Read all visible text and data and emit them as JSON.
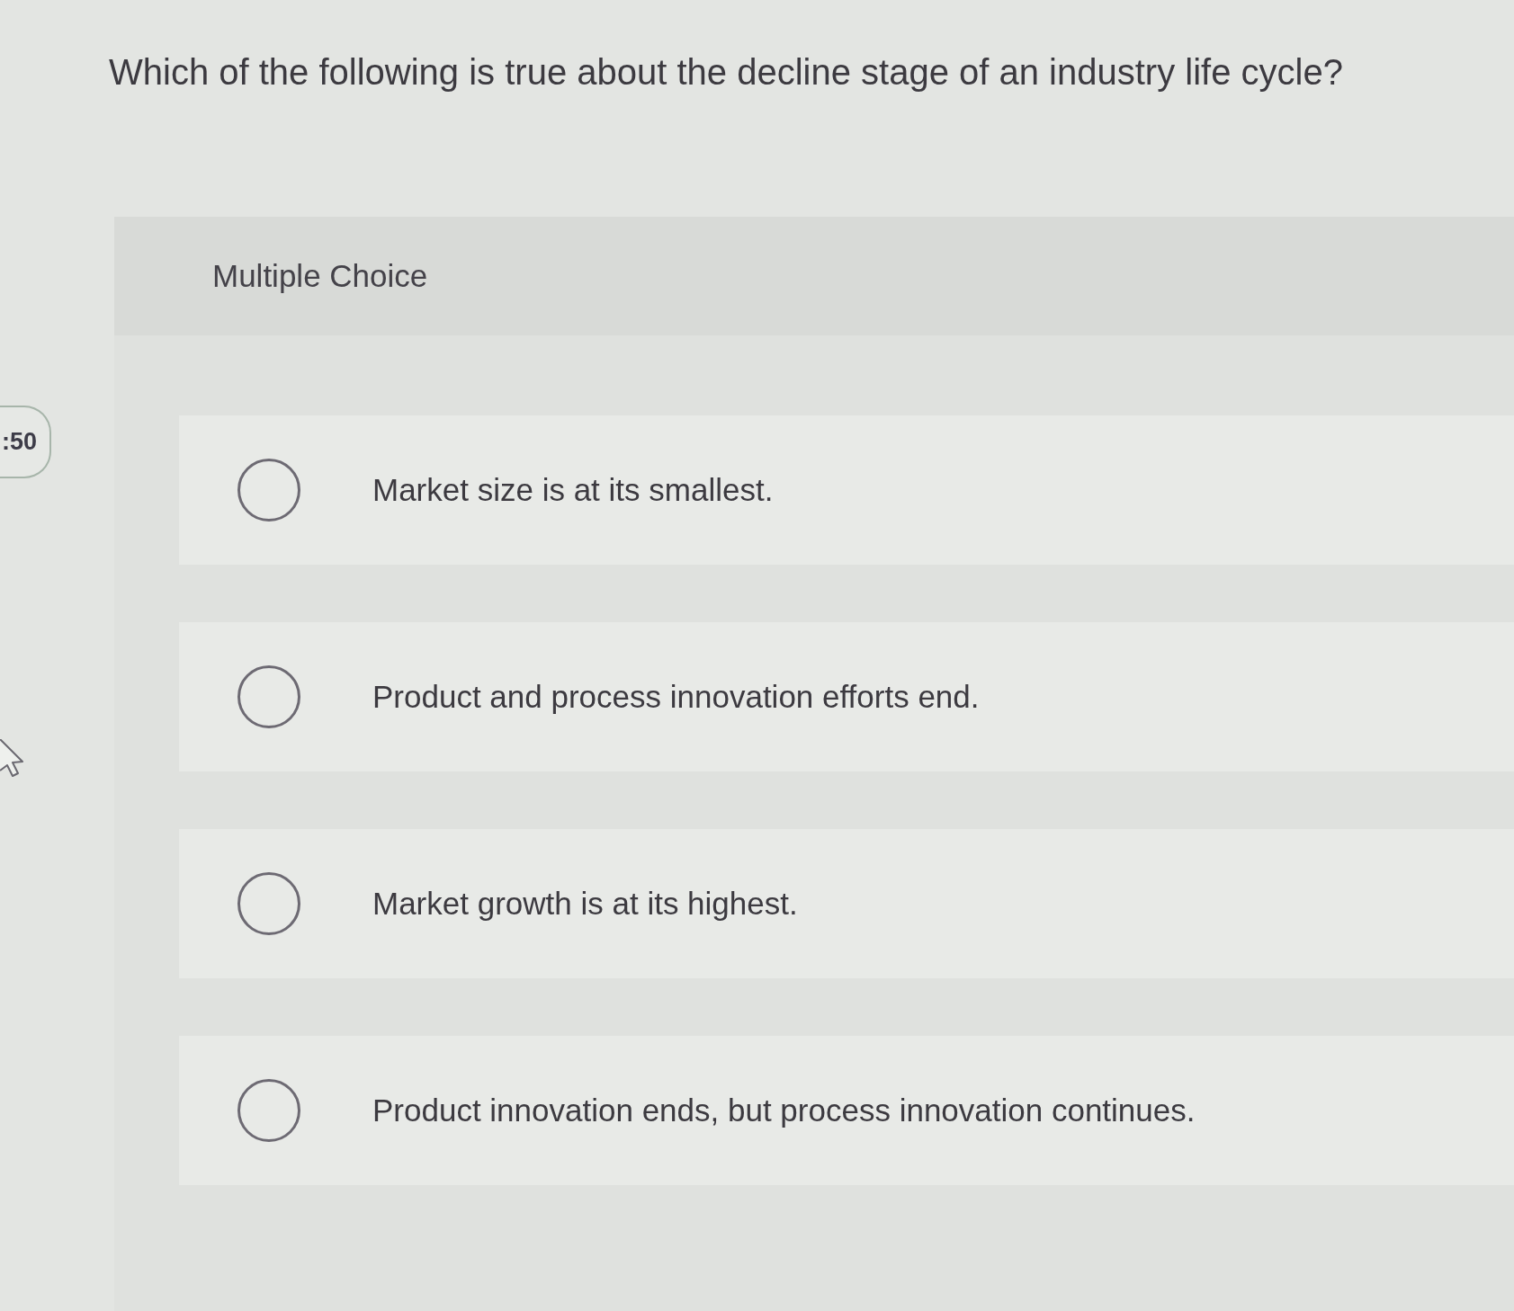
{
  "question": "Which of the following is true about the decline stage of an industry life cycle?",
  "timer_badge": ":50",
  "panel": {
    "heading": "Multiple Choice",
    "options": [
      {
        "label": "Market size is at its smallest.",
        "selected": false
      },
      {
        "label": "Product and process innovation efforts end.",
        "selected": false
      },
      {
        "label": "Market growth is at its highest.",
        "selected": false
      },
      {
        "label": "Product innovation ends, but process innovation continues.",
        "selected": false
      }
    ]
  }
}
